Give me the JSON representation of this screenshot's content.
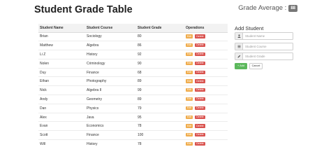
{
  "header": {
    "title": "Student Grade Table",
    "grade_average_label": "Grade Average :",
    "grade_average_value": "88"
  },
  "table": {
    "columns": [
      "Student Name",
      "Student Course",
      "Student Grade",
      "Operations"
    ],
    "edit_label": "Edit",
    "delete_label": "Delete",
    "rows": [
      {
        "name": "Brian",
        "course": "Sociology",
        "grade": "80"
      },
      {
        "name": "Matthew",
        "course": "Algebra",
        "grade": "86"
      },
      {
        "name": "Li Z",
        "course": "History",
        "grade": "92"
      },
      {
        "name": "Nolen",
        "course": "Criminology",
        "grade": "90"
      },
      {
        "name": "Duy",
        "course": "Finance",
        "grade": "68"
      },
      {
        "name": "Ethan",
        "course": "Photography",
        "grade": "89"
      },
      {
        "name": "Nick",
        "course": "Algebra II",
        "grade": "99"
      },
      {
        "name": "Andy",
        "course": "Geometry",
        "grade": "89"
      },
      {
        "name": "Dan",
        "course": "Physics",
        "grade": "79"
      },
      {
        "name": "Alex",
        "course": "Java",
        "grade": "95"
      },
      {
        "name": "Evan",
        "course": "Economics",
        "grade": "78"
      },
      {
        "name": "Scott",
        "course": "Finance",
        "grade": "100"
      },
      {
        "name": "Will",
        "course": "History",
        "grade": "78"
      }
    ]
  },
  "form": {
    "title": "Add Student",
    "name_placeholder": "Student Name",
    "course_placeholder": "Student Course",
    "grade_placeholder": "Student Grade",
    "name_value": "",
    "course_value": "",
    "grade_value": "",
    "add_label": "Add",
    "cancel_label": "Cancel"
  },
  "icons": {
    "name": "user-icon",
    "course": "list-icon",
    "grade": "pencil-icon",
    "add": "plus-icon"
  },
  "colors": {
    "edit": "#f0ad4e",
    "delete": "#d9534f",
    "add": "#5cb85c",
    "badge": "#777777"
  }
}
